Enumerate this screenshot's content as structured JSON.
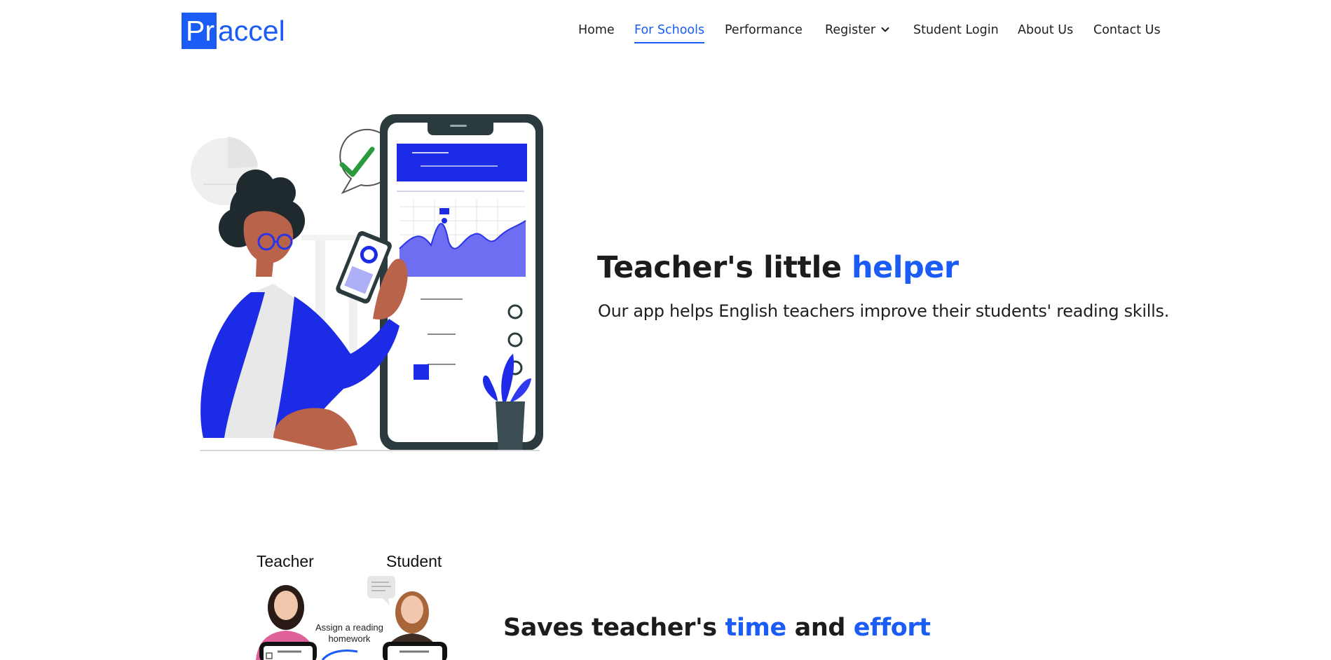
{
  "nav": {
    "logo": {
      "highlight": "Pr",
      "rest": "accel"
    },
    "items": [
      {
        "label": "Home",
        "active": false
      },
      {
        "label": "For Schools",
        "active": true
      },
      {
        "label": "Performance",
        "active": false
      },
      {
        "label": "Register",
        "active": false,
        "dropdown": true
      },
      {
        "label": "Student Login",
        "active": false
      },
      {
        "label": "About Us",
        "active": false
      },
      {
        "label": "Contact Us",
        "active": false
      }
    ]
  },
  "hero": {
    "title_plain": "Teacher's little ",
    "title_accent": "helper",
    "subtitle": "Our app helps English teachers improve their students' reading skills."
  },
  "section2": {
    "diagram": {
      "teacher_label": "Teacher",
      "student_label": "Student",
      "note": [
        "Assign a reading",
        "homework"
      ]
    },
    "title": [
      {
        "text": "Saves teacher's ",
        "accent": false
      },
      {
        "text": "time",
        "accent": true
      },
      {
        "text": " and ",
        "accent": false
      },
      {
        "text": "effort",
        "accent": true
      }
    ]
  },
  "colors": {
    "accent": "#1a5cf5",
    "text": "#1c1c1c",
    "illustration_blue": "#1f2be8",
    "skin": "#b9634a",
    "hair": "#1f2a2f"
  }
}
